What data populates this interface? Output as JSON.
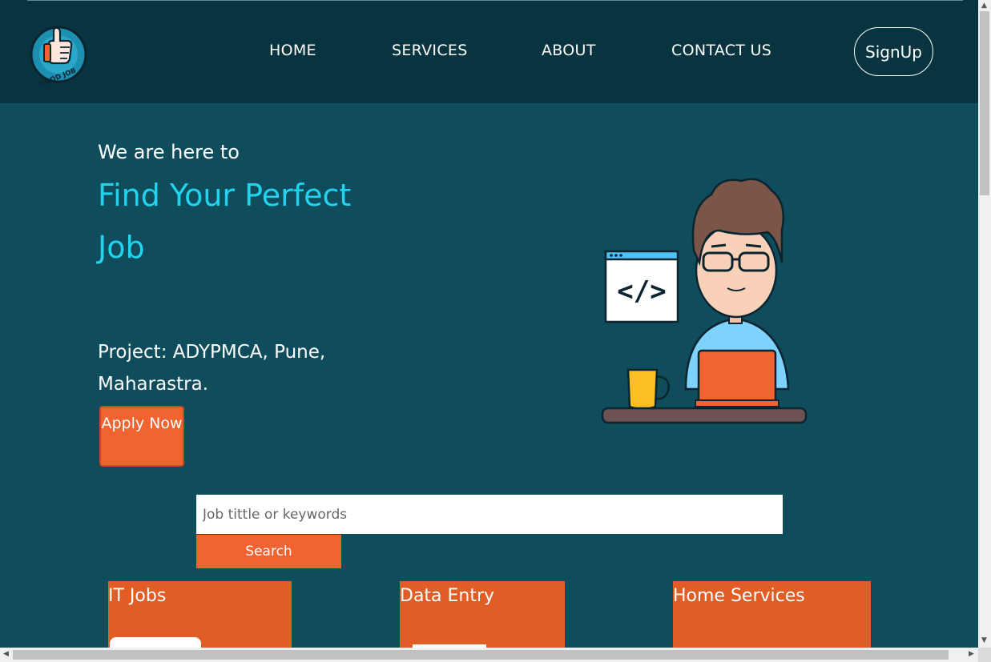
{
  "nav": {
    "links": [
      "HOME",
      "SERVICES",
      "ABOUT",
      "CONTACT US"
    ],
    "signup_label": "SignUp",
    "logo_text": "GOOD JOB"
  },
  "hero": {
    "subtitle": "We are here to",
    "title": "Find Your Perfect Job",
    "project": "Project: ADYPMCA, Pune, Maharastra.",
    "apply_label": "Apply Now",
    "code_symbol": "</>"
  },
  "search": {
    "placeholder": "Job tittle or keywords",
    "button_label": "Search"
  },
  "categories": [
    "IT Jobs",
    "Data Entry",
    "Home Services"
  ],
  "colors": {
    "navbar": "#07343f",
    "background": "#0f4c5c",
    "accent": "#f26332",
    "title": "#22d3ee"
  }
}
